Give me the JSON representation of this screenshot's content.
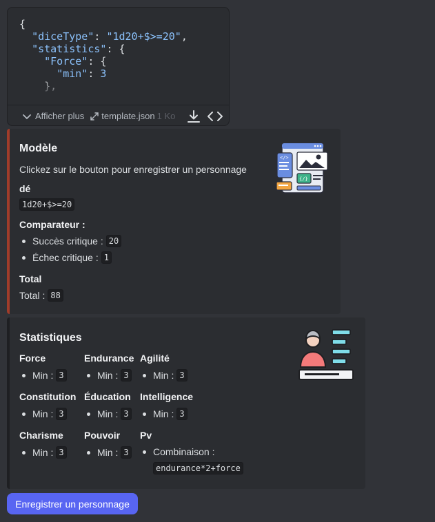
{
  "code_preview": {
    "lines": [
      [
        {
          "t": "punc",
          "v": "{"
        }
      ],
      [
        {
          "t": "punc",
          "v": "  "
        },
        {
          "t": "key",
          "v": "\"diceType\""
        },
        {
          "t": "punc",
          "v": ": "
        },
        {
          "t": "str",
          "v": "\"1d20+$>=20\""
        },
        {
          "t": "punc",
          "v": ","
        }
      ],
      [
        {
          "t": "punc",
          "v": "  "
        },
        {
          "t": "key",
          "v": "\"statistics\""
        },
        {
          "t": "punc",
          "v": ": {"
        }
      ],
      [
        {
          "t": "punc",
          "v": "    "
        },
        {
          "t": "key",
          "v": "\"Force\""
        },
        {
          "t": "punc",
          "v": ": {"
        }
      ],
      [
        {
          "t": "punc",
          "v": "      "
        },
        {
          "t": "key",
          "v": "\"min\""
        },
        {
          "t": "punc",
          "v": ": "
        },
        {
          "t": "num",
          "v": "3"
        }
      ],
      [
        {
          "t": "punc",
          "v": "    },"
        }
      ]
    ],
    "expand_label": "Afficher plus",
    "filename": "template.json",
    "filesize": "1 Ko"
  },
  "model_embed": {
    "title": "Modèle",
    "description": "Clickez sur le bouton pour enregistrer un personnage",
    "dice_label": "dé",
    "dice_value": "1d20+$>=20",
    "comparator_label": "Comparateur :",
    "critical_success_label": "Succès critique :",
    "critical_success_value": "20",
    "critical_fail_label": "Échec critique :",
    "critical_fail_value": "1",
    "total_label": "Total",
    "total_line_label": "Total :",
    "total_value": "88",
    "accent_color": "#a13c2a"
  },
  "stats_embed": {
    "title": "Statistiques",
    "fields": [
      {
        "name": "Force",
        "line": "Min :",
        "value": "3"
      },
      {
        "name": "Endurance",
        "line": "Min :",
        "value": "3"
      },
      {
        "name": "Agilité",
        "line": "Min :",
        "value": "3"
      },
      {
        "name": "Constitution",
        "line": "Min :",
        "value": "3"
      },
      {
        "name": "Éducation",
        "line": "Min :",
        "value": "3"
      },
      {
        "name": "Intelligence",
        "line": "Min :",
        "value": "3"
      },
      {
        "name": "Charisme",
        "line": "Min :",
        "value": "3"
      },
      {
        "name": "Pouvoir",
        "line": "Min :",
        "value": "3"
      },
      {
        "name": "Pv",
        "line": "Combinaison :",
        "value": "endurance*2+force"
      }
    ]
  },
  "register_button": {
    "label": "Enregistrer un personnage",
    "color": "#5865f2"
  }
}
